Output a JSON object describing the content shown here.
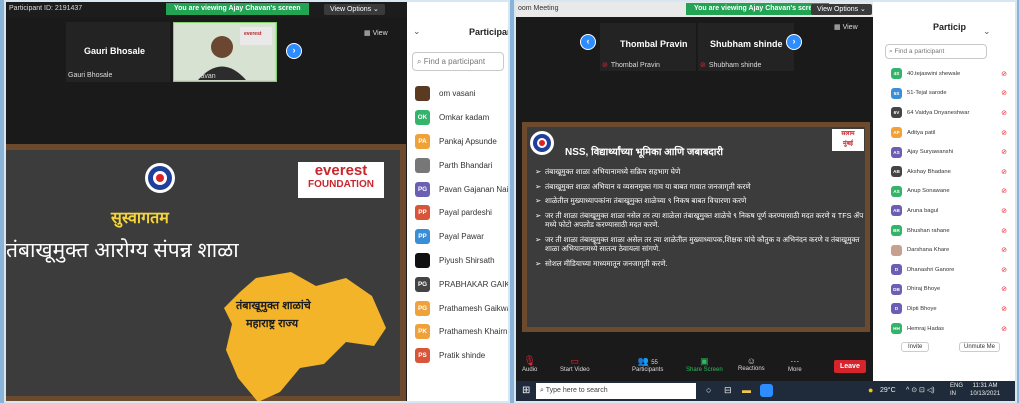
{
  "left": {
    "participant_id": "Participant ID: 2191437",
    "viewing_banner": "You are viewing Ajay Chavan's screen",
    "view_options": "View Options ⌄",
    "tiles": [
      {
        "name": "Gauri Bhosale",
        "label": "Gauri Bhosale"
      },
      {
        "name": "",
        "label": "Ajay Chavan"
      }
    ],
    "view_label": "View",
    "slide": {
      "org_line1": "everest",
      "org_line2": "FOUNDATION",
      "welcome": "सुस्वागतम",
      "headline": "तंबाखूमुक्त आरोग्य संपन्न शाळा",
      "map_text_1": "तंबाखूमुक्त शाळांचे",
      "map_text_2": "महाराष्ट्र राज्य"
    },
    "panel": {
      "title": "Participan",
      "search_placeholder": "Find a participant",
      "participants": [
        {
          "initials": "",
          "name": "om vasani",
          "color": "#5a3a20",
          "photo": true
        },
        {
          "initials": "OK",
          "name": "Omkar kadam",
          "color": "#34b36a"
        },
        {
          "initials": "PA",
          "name": "Pankaj Apsunde",
          "color": "#f0a23a"
        },
        {
          "initials": "",
          "name": "Parth Bhandari",
          "color": "#777777",
          "photo": true
        },
        {
          "initials": "PG",
          "name": "Pavan Gajanan Nai",
          "color": "#6b5fb3"
        },
        {
          "initials": "PP",
          "name": "Payal pardeshi",
          "color": "#d8553a"
        },
        {
          "initials": "PP",
          "name": "Payal Pawar",
          "color": "#3a8ed8"
        },
        {
          "initials": "",
          "name": "Piyush Shirsath",
          "color": "#111111",
          "photo": true
        },
        {
          "initials": "PG",
          "name": "PRABHAKAR GAIKW",
          "color": "#444444"
        },
        {
          "initials": "PG",
          "name": "Prathamesh Gaikwa",
          "color": "#f0a23a"
        },
        {
          "initials": "PK",
          "name": "Prathamesh Khairn",
          "color": "#f0a23a"
        },
        {
          "initials": "PS",
          "name": "Pratik shinde",
          "color": "#d8553a"
        }
      ]
    }
  },
  "right": {
    "meeting_title": "oom Meeting",
    "viewing_banner": "You are viewing Ajay Chavan's screen",
    "view_options": "View Options ⌄",
    "tiles": [
      {
        "name": "Thombal Pravin",
        "label": "Thombal Pravin"
      },
      {
        "name": "Shubham shinde",
        "label": "Shubham shinde"
      }
    ],
    "view_label": "View",
    "slide": {
      "title": "NSS, विद्यार्थ्यांच्या भूमिका आणि जबाबदारी",
      "corner_1": "सलाम",
      "corner_2": "मुंबई",
      "bullets": [
        "तंबाखूमुक्त शाळा अभियानामध्ये सक्रिय सहभाग घेणे",
        "तंबाखूमुक्त शाळा अभियान व व्यसनमुक्त गाव या बाबत गावात जनजागृती करणे",
        "शाळेतील मुख्याध्यापकांना तंबाखूमुक्त शाळेच्या ९ निकष बाबत विचारणा करणे",
        "जर ती शाळा तंबाखूमुक्त शाळा नसेल तर त्या शाळेला तंबाखूमुक्त शाळेचे ९ निकष पूर्ण करण्यासाठी मदत करणे व TFS ॲप मध्ये फोटो अपलोड करण्यासाठी मदत करणे.",
        "जर ती शाळा तंबाखूमुक्त शाळा असेल तर त्या शाळेतील मुख्याध्यापक,शिक्षक यांचे कौतुक व अभिनंदन करणे व तंबाखूमुक्त शाळा अभियानामध्ये सातत्य ठेवायला सांगणे.",
        "सोशल मीडियाच्या माध्यमातून जनजागृती करणे."
      ]
    },
    "toolbar": {
      "audio": "Audio",
      "start_video": "Start Video",
      "participants": "Participants",
      "participants_count": "55",
      "share_screen": "Share Screen",
      "reactions": "Reactions",
      "more": "More",
      "leave": "Leave"
    },
    "taskbar": {
      "search_placeholder": "Type here to search",
      "weather": "29°C",
      "lang_1": "ENG",
      "lang_2": "IN",
      "time": "11:31 AM",
      "date": "10/13/2021"
    },
    "panel": {
      "title": "Particip",
      "search_placeholder": "Find a participant",
      "participants": [
        {
          "initials": "4S",
          "name": "40.tejaswini shewale",
          "color": "#34b36a"
        },
        {
          "initials": "5S",
          "name": "51-Tejal sarode",
          "color": "#3a8ed8"
        },
        {
          "initials": "6V",
          "name": "64 Vaidya Dnyaneshwar",
          "color": "#444444"
        },
        {
          "initials": "AP",
          "name": "Aditya patil",
          "color": "#f0a23a"
        },
        {
          "initials": "AS",
          "name": "Ajay Suryawanshi",
          "color": "#6b5fb3"
        },
        {
          "initials": "AB",
          "name": "Akshay Bhadane",
          "color": "#444444"
        },
        {
          "initials": "AS",
          "name": "Anup Sonawane",
          "color": "#34b36a"
        },
        {
          "initials": "AB",
          "name": "Aruna bagul",
          "color": "#6b5fb3"
        },
        {
          "initials": "BR",
          "name": "Bhushan rahane",
          "color": "#34b36a"
        },
        {
          "initials": "",
          "name": "Darshana Khare",
          "color": "#c8a090",
          "photo": true
        },
        {
          "initials": "D",
          "name": "Dhanashri Ganore",
          "color": "#6b5fb3"
        },
        {
          "initials": "DB",
          "name": "Dhiraj Bhoye",
          "color": "#6b5fb3"
        },
        {
          "initials": "D",
          "name": "Dipti Bhoye",
          "color": "#6b5fb3"
        },
        {
          "initials": "HH",
          "name": "Hemraj Hadas",
          "color": "#34b36a"
        }
      ],
      "invite": "Invite",
      "unmute_me": "Unmute Me"
    }
  }
}
